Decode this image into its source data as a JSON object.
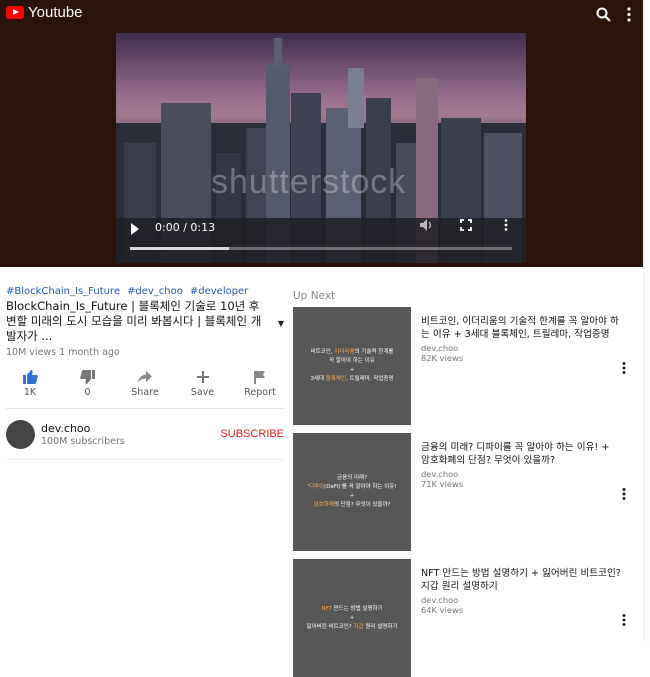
{
  "app": {
    "title": "Youtube"
  },
  "player": {
    "time": "0:00 / 0:13",
    "watermark": "shutterstock",
    "progress": 0.26
  },
  "video": {
    "hashtags": [
      "#BlockChain_Is_Future",
      "#dev_choo",
      "#developer"
    ],
    "title": "BlockChain_Is_Future | 블록체인 기술로 10년 후 변할 미래의 도시 모습을 미리 봐봅시다 | 블록체인 개발자가 ...",
    "meta": "10M views 1 month ago",
    "actions": {
      "like": "1K",
      "dislike": "0",
      "share": "Share",
      "save": "Save",
      "report": "Report"
    }
  },
  "channel": {
    "name": "dev.choo",
    "subscribers": "100M subscribers",
    "subscribe": "SUBSCRIBE"
  },
  "up_next": {
    "label": "Up Next",
    "items": [
      {
        "title": "비트코인, 이더리움의 기술적 한계를 꼭 알아야 하는 이유 + 3세대 블록체인, 트릴레마, 작업증명",
        "channel": "dev.choo",
        "views": "82K views"
      },
      {
        "title": "금융의 미래? 디파이를 꼭 알아야 하는 이유! + 암호화폐의 단점? 무엇이 있을까?",
        "channel": "dev.choo",
        "views": "71K views"
      },
      {
        "title": "NFT 만드는 방법 설명하기 + 잃어버린 비트코인? 지갑 원리 설명하기",
        "channel": "dev.choo",
        "views": "64K views"
      }
    ]
  }
}
